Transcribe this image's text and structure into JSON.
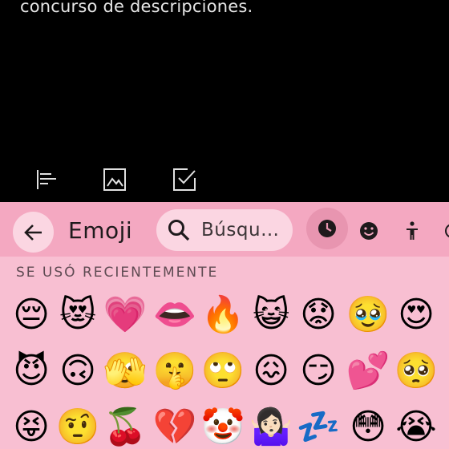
{
  "note": {
    "text": "concurso de descripciones."
  },
  "toolbar": {
    "icons": [
      "text-format-icon",
      "image-icon",
      "checkbox-icon"
    ]
  },
  "keyboard": {
    "title": "Emoji",
    "search_placeholder": "Búsqu…",
    "section_label": "SE USÓ RECIENTEMENTE",
    "categories": [
      "recent-clock-icon",
      "smiley-icon",
      "person-icon",
      "more-icon"
    ],
    "emoji_rows": [
      [
        "😔",
        "😻",
        "💗",
        "👄",
        "🔥",
        "😺",
        "😟",
        "🥹",
        "😍"
      ],
      [
        "😈",
        "🙃",
        "🫣",
        "🤫",
        "🙄",
        "😖",
        "😏",
        "💕",
        "🥺"
      ],
      [
        "😝",
        "🤨",
        "🍒",
        "💔",
        "🤡",
        "🤷🏻‍♀️",
        "💤",
        "😳",
        "😭"
      ]
    ]
  },
  "colors": {
    "keyboard_bg": "#f8bfd2",
    "header_bg": "#f4a8c1",
    "accent": "#e895b0"
  }
}
